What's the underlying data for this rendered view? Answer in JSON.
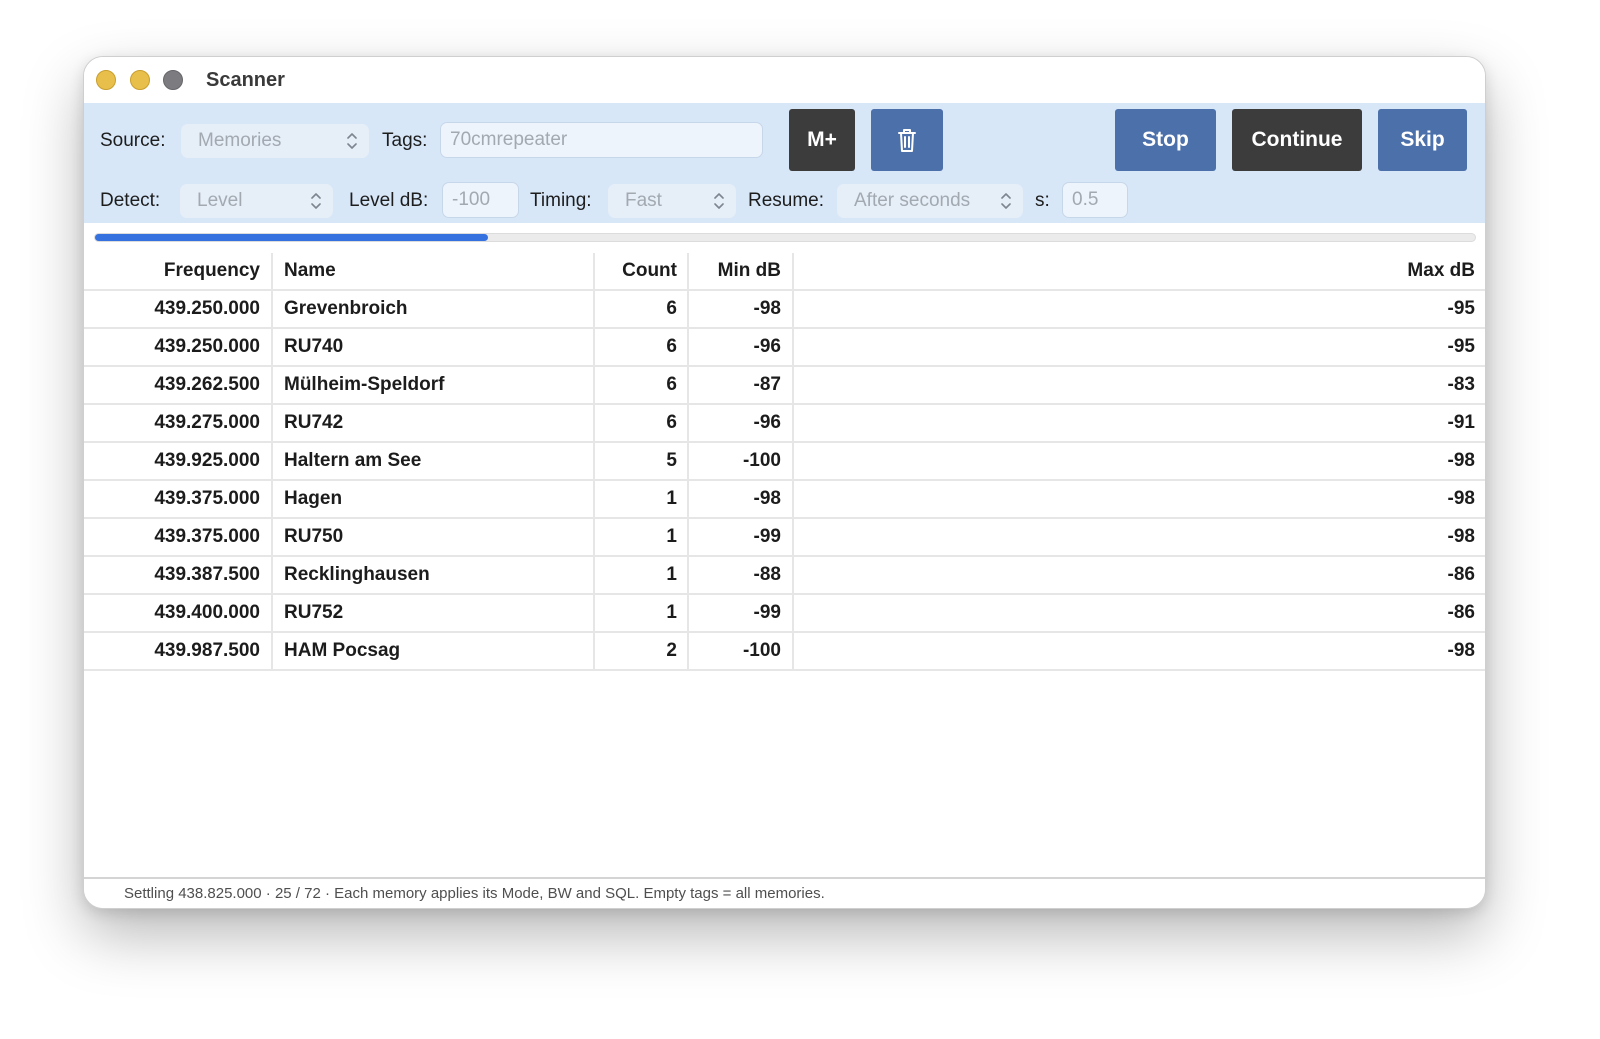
{
  "window": {
    "title": "Scanner"
  },
  "toolbar": {
    "source_label": "Source:",
    "source_value": "Memories",
    "tags_label": "Tags:",
    "tags_placeholder": "70cmrepeater",
    "mplus_label": "M+",
    "delete_icon": "trash-icon",
    "stop_label": "Stop",
    "continue_label": "Continue",
    "skip_label": "Skip",
    "detect_label": "Detect:",
    "detect_value": "Level",
    "level_label": "Level dB:",
    "level_value": "-100",
    "timing_label": "Timing:",
    "timing_value": "Fast",
    "resume_label": "Resume:",
    "resume_value": "After seconds",
    "seconds_label": "s:",
    "seconds_value": "0.5"
  },
  "progress": {
    "value": 0.2847
  },
  "table": {
    "headers": [
      "Frequency",
      "Name",
      "Count",
      "Min dB",
      "Max dB"
    ],
    "rows": [
      [
        "439.250.000",
        "Grevenbroich",
        "6",
        "-98",
        "-95"
      ],
      [
        "439.250.000",
        "RU740",
        "6",
        "-96",
        "-95"
      ],
      [
        "439.262.500",
        "Mülheim-Speldorf",
        "6",
        "-87",
        "-83"
      ],
      [
        "439.275.000",
        "RU742",
        "6",
        "-96",
        "-91"
      ],
      [
        "439.925.000",
        "Haltern am See",
        "5",
        "-100",
        "-98"
      ],
      [
        "439.375.000",
        "Hagen",
        "1",
        "-98",
        "-98"
      ],
      [
        "439.375.000",
        "RU750",
        "1",
        "-99",
        "-98"
      ],
      [
        "439.387.500",
        "Recklinghausen",
        "1",
        "-88",
        "-86"
      ],
      [
        "439.400.000",
        "RU752",
        "1",
        "-99",
        "-86"
      ],
      [
        "439.987.500",
        "HAM Pocsag",
        "2",
        "-100",
        "-98"
      ]
    ]
  },
  "status": {
    "text": "Settling 438.825.000 · 25 / 72 · Each memory applies its Mode, BW and SQL. Empty tags = all memories."
  },
  "colors": {
    "accent": "#3671e0",
    "toolbar_bg": "#d7e7f8",
    "button_blue": "#4b70aa",
    "button_dark": "#3c3c3c"
  }
}
